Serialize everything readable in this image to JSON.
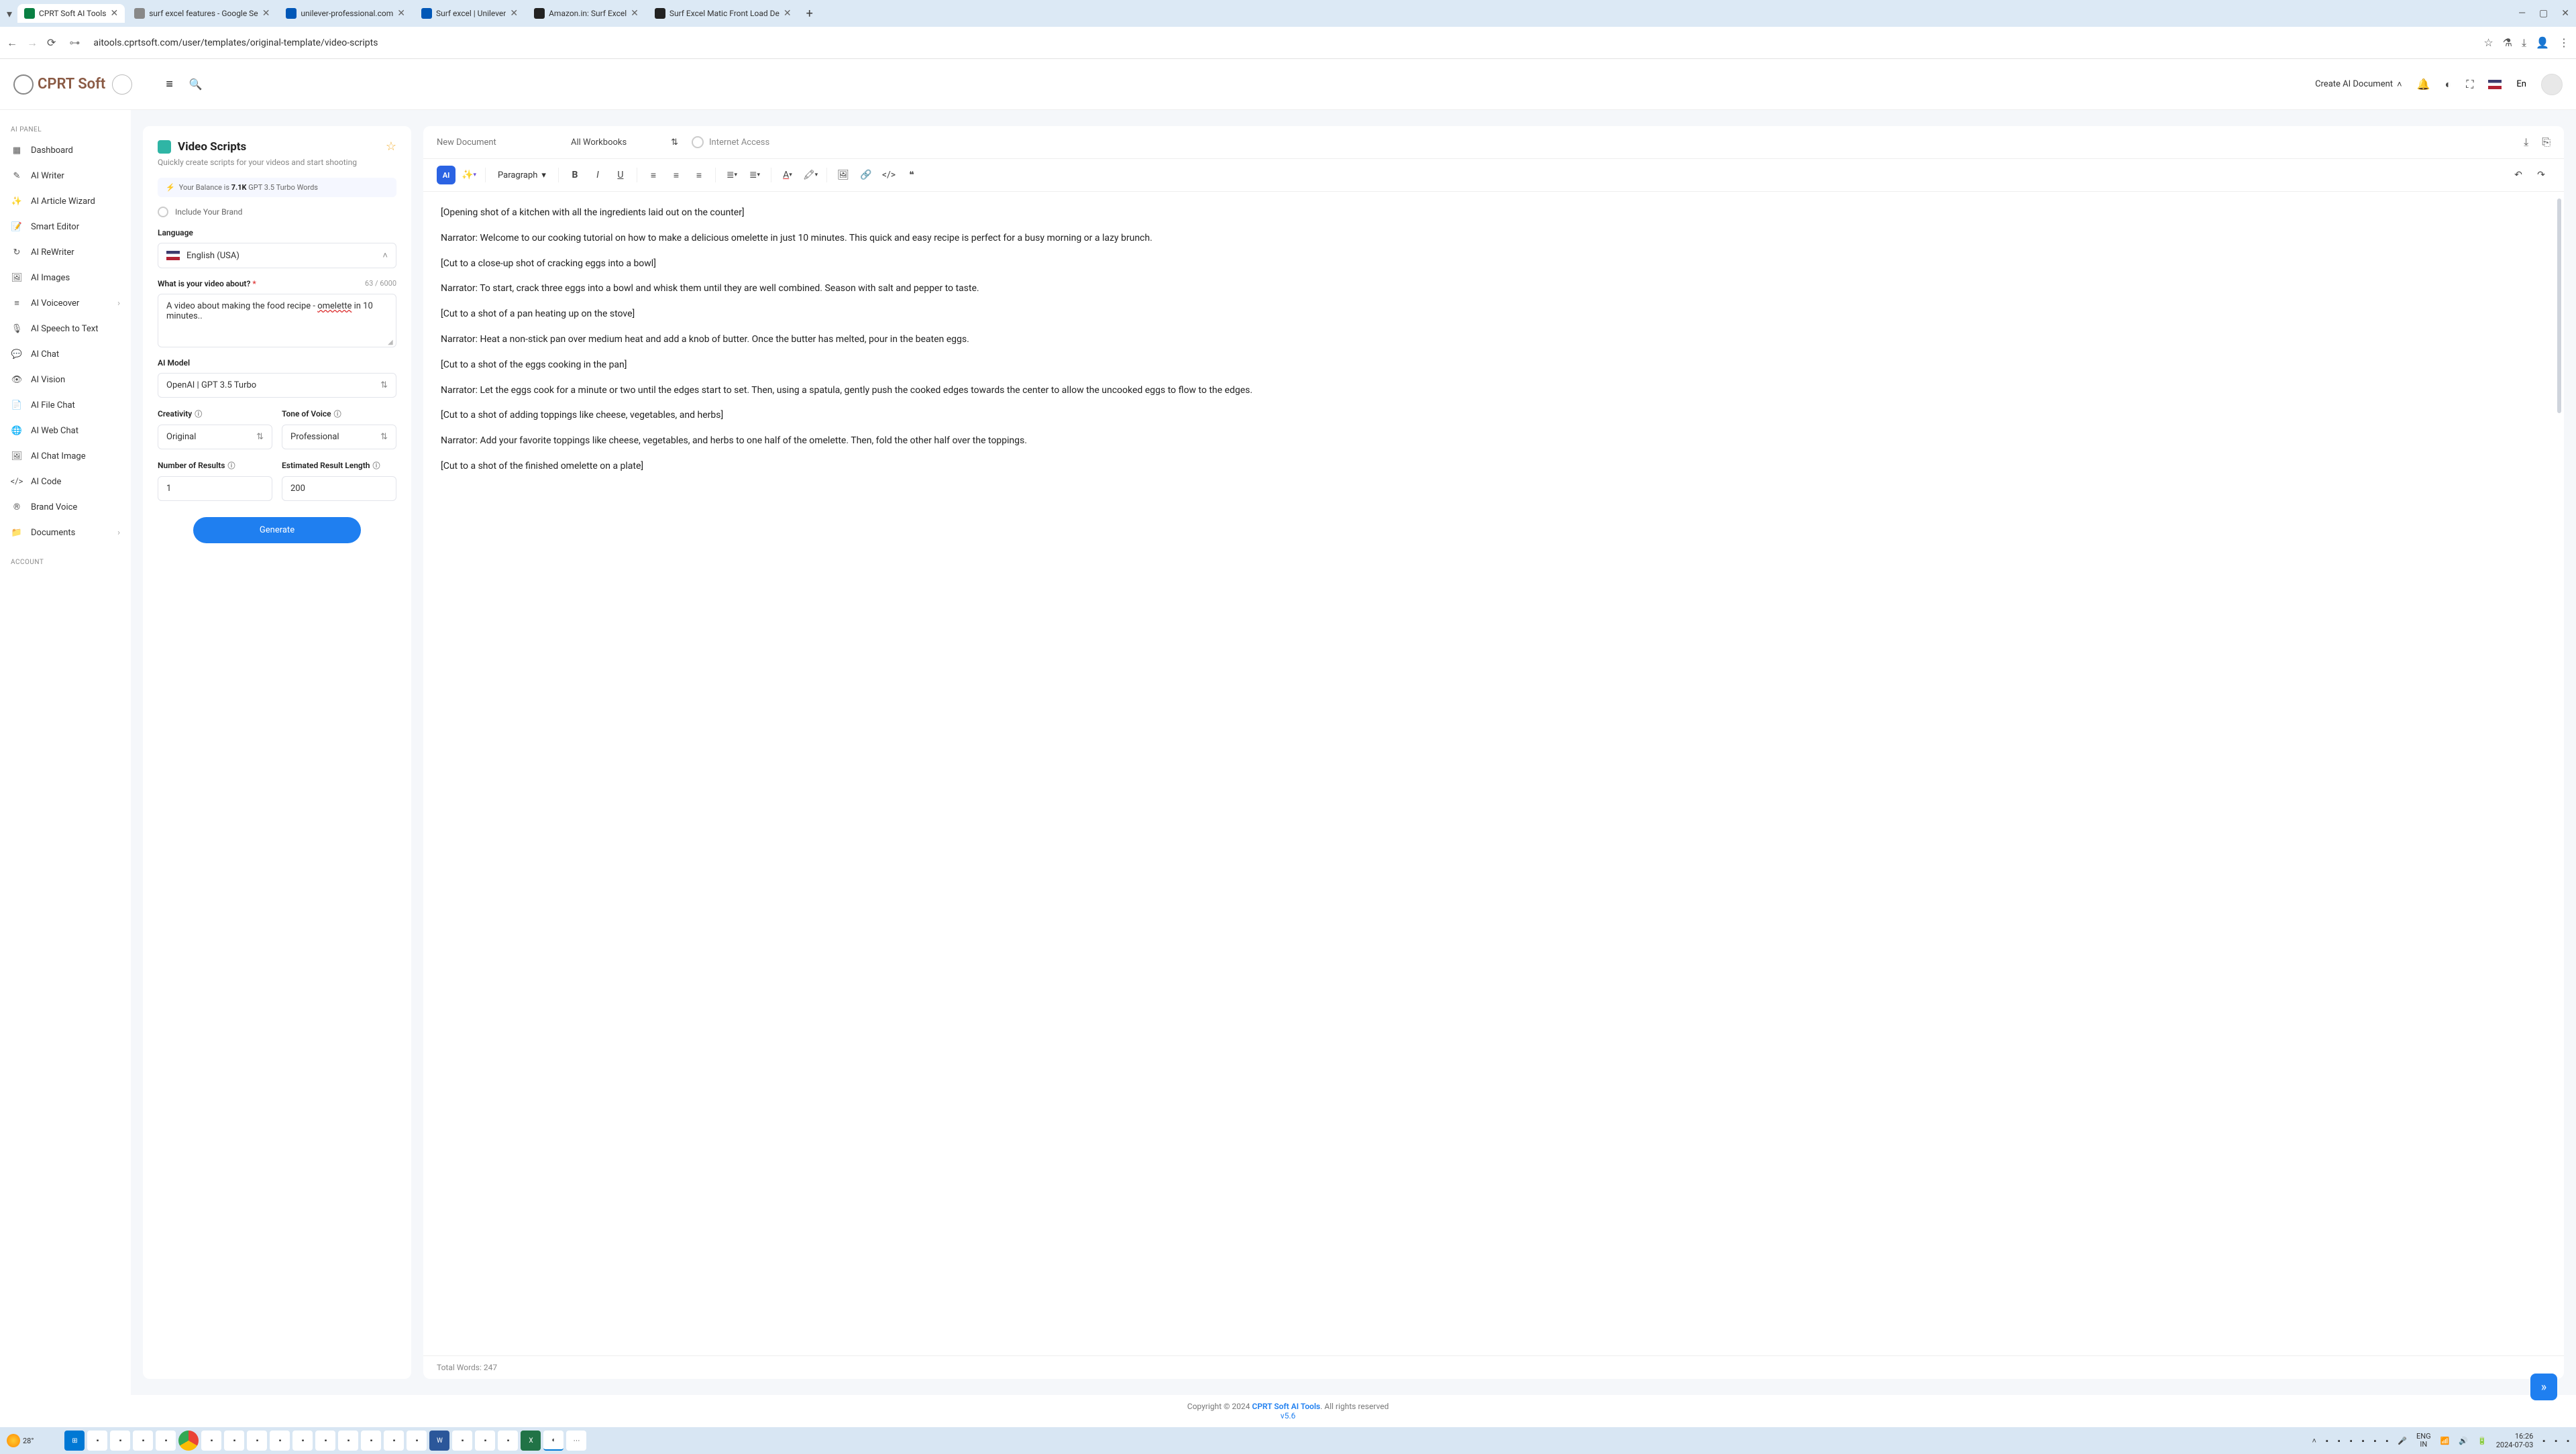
{
  "browser": {
    "tabs": [
      {
        "title": "CPRT Soft AI Tools",
        "active": true,
        "favicon": "green"
      },
      {
        "title": "surf excel features - Google Se",
        "favicon": "google"
      },
      {
        "title": "unilever-professional.com",
        "favicon": "blue"
      },
      {
        "title": "Surf excel | Unilever",
        "favicon": "blue"
      },
      {
        "title": "Amazon.in: Surf Excel",
        "favicon": "amazon"
      },
      {
        "title": "Surf Excel Matic Front Load De",
        "favicon": "amazon"
      }
    ],
    "url": "aitools.cprtsoft.com/user/templates/original-template/video-scripts",
    "window_controls": {
      "min": "—",
      "max": "▢",
      "close": "✕"
    }
  },
  "header": {
    "logo_text": "CPRT Soft",
    "menu_toggle": "≡",
    "create_doc": "Create AI Document",
    "lang": "En"
  },
  "sidebar": {
    "section1": "AI PANEL",
    "items": [
      {
        "icon": "grid",
        "label": "Dashboard"
      },
      {
        "icon": "pen",
        "label": "AI Writer"
      },
      {
        "icon": "wand",
        "label": "AI Article Wizard"
      },
      {
        "icon": "edit",
        "label": "Smart Editor"
      },
      {
        "icon": "rewrite",
        "label": "AI ReWriter"
      },
      {
        "icon": "image",
        "label": "AI Images"
      },
      {
        "icon": "voice",
        "label": "AI Voiceover",
        "expandable": true
      },
      {
        "icon": "speech",
        "label": "AI Speech to Text"
      },
      {
        "icon": "chat",
        "label": "AI Chat"
      },
      {
        "icon": "eye",
        "label": "AI Vision"
      },
      {
        "icon": "file",
        "label": "AI File Chat"
      },
      {
        "icon": "globe",
        "label": "AI Web Chat"
      },
      {
        "icon": "chatimg",
        "label": "AI Chat Image"
      },
      {
        "icon": "code",
        "label": "AI Code"
      },
      {
        "icon": "brand",
        "label": "Brand Voice"
      },
      {
        "icon": "docs",
        "label": "Documents",
        "expandable": true
      }
    ],
    "section2": "ACCOUNT"
  },
  "form": {
    "title": "Video Scripts",
    "subtitle": "Quickly create scripts for your videos and start shooting",
    "balance_prefix": "Your Balance is ",
    "balance_value": "7.1K",
    "balance_suffix": " GPT 3.5 Turbo Words",
    "include_brand": "Include Your Brand",
    "language_label": "Language",
    "language_value": "English (USA)",
    "about_label": "What is your video about? ",
    "about_count": "63 / 6000",
    "about_value": "A video about making the food recipe - omelette in 10 minutes..",
    "about_misspell": "omelette",
    "model_label": "AI Model",
    "model_value": "OpenAI | GPT 3.5 Turbo",
    "creativity_label": "Creativity",
    "creativity_value": "Original",
    "tone_label": "Tone of Voice",
    "tone_value": "Professional",
    "results_label": "Number of Results",
    "results_value": "1",
    "length_label": "Estimated Result Length",
    "length_value": "200",
    "generate_btn": "Generate"
  },
  "editor": {
    "doc_name_placeholder": "New Document",
    "workbook": "All Workbooks",
    "internet": "Internet Access",
    "para_style": "Paragraph",
    "content": [
      "[Opening shot of a kitchen with all the ingredients laid out on the counter]",
      "Narrator: Welcome to our cooking tutorial on how to make a delicious omelette in just 10 minutes. This quick and easy recipe is perfect for a busy morning or a lazy brunch.",
      "[Cut to a close-up shot of cracking eggs into a bowl]",
      "Narrator: To start, crack three eggs into a bowl and whisk them until they are well combined. Season with salt and pepper to taste.",
      "[Cut to a shot of a pan heating up on the stove]",
      "Narrator: Heat a non-stick pan over medium heat and add a knob of butter. Once the butter has melted, pour in the beaten eggs.",
      "[Cut to a shot of the eggs cooking in the pan]",
      "Narrator: Let the eggs cook for a minute or two until the edges start to set. Then, using a spatula, gently push the cooked edges towards the center to allow the uncooked eggs to flow to the edges.",
      "[Cut to a shot of adding toppings like cheese, vegetables, and herbs]",
      "Narrator: Add your favorite toppings like cheese, vegetables, and herbs to one half of the omelette. Then, fold the other half over the toppings.",
      "[Cut to a shot of the finished omelette on a plate]"
    ],
    "word_count_label": "Total Words: ",
    "word_count": "247"
  },
  "footer": {
    "copyright_prefix": "Copyright © 2024 ",
    "brand": "CPRT Soft AI Tools",
    "copyright_suffix": ". All rights reserved",
    "version": "v5.6"
  },
  "taskbar": {
    "weather_temp": "28°",
    "lang": "ENG",
    "region": "IN",
    "time": "16:26",
    "date": "2024-07-03"
  }
}
